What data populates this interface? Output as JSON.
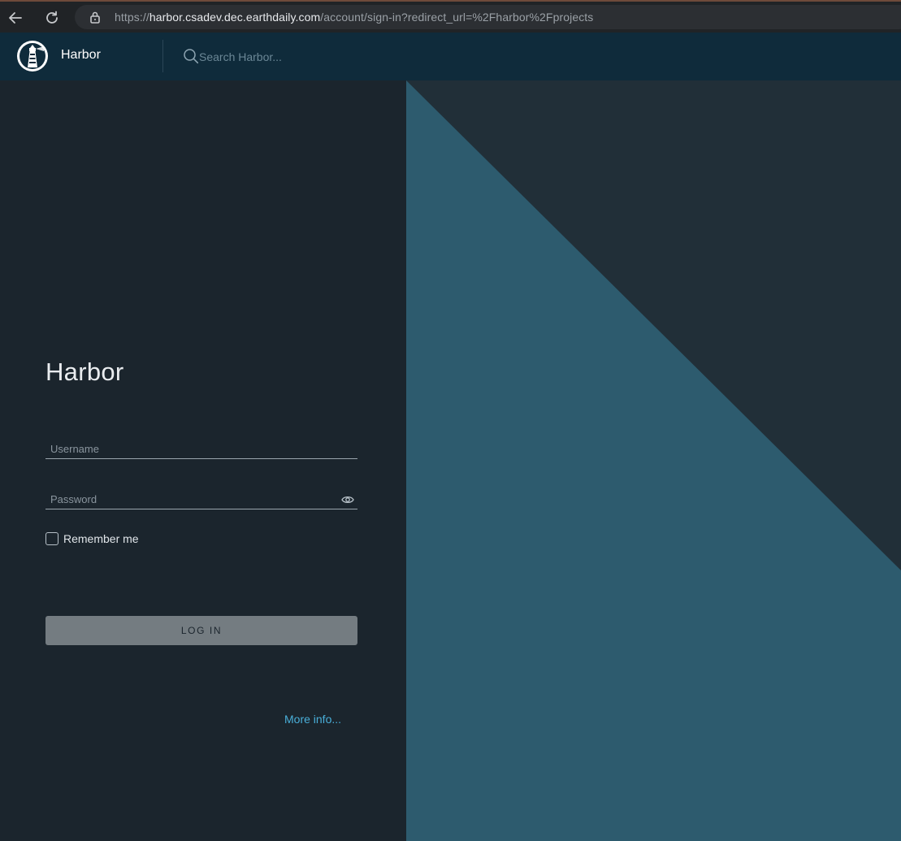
{
  "browser": {
    "url_scheme": "https://",
    "url_host": "harbor.csadev.dec.earthdaily.com",
    "url_path": "/account/sign-in?redirect_url=%2Fharbor%2Fprojects"
  },
  "header": {
    "brand": "Harbor",
    "search_placeholder": "Search Harbor..."
  },
  "login": {
    "title": "Harbor",
    "username_placeholder": "Username",
    "password_placeholder": "Password",
    "remember_label": "Remember me",
    "remember_checked": false,
    "login_button": "LOG IN",
    "more_info": "More info..."
  },
  "colors": {
    "header_bg": "#0f2b3b",
    "panel_bg": "#1b252d",
    "hero_bg": "#212f38",
    "hero_accent": "#2d5b6e",
    "link": "#49afd9",
    "button_disabled": "#747c81"
  }
}
